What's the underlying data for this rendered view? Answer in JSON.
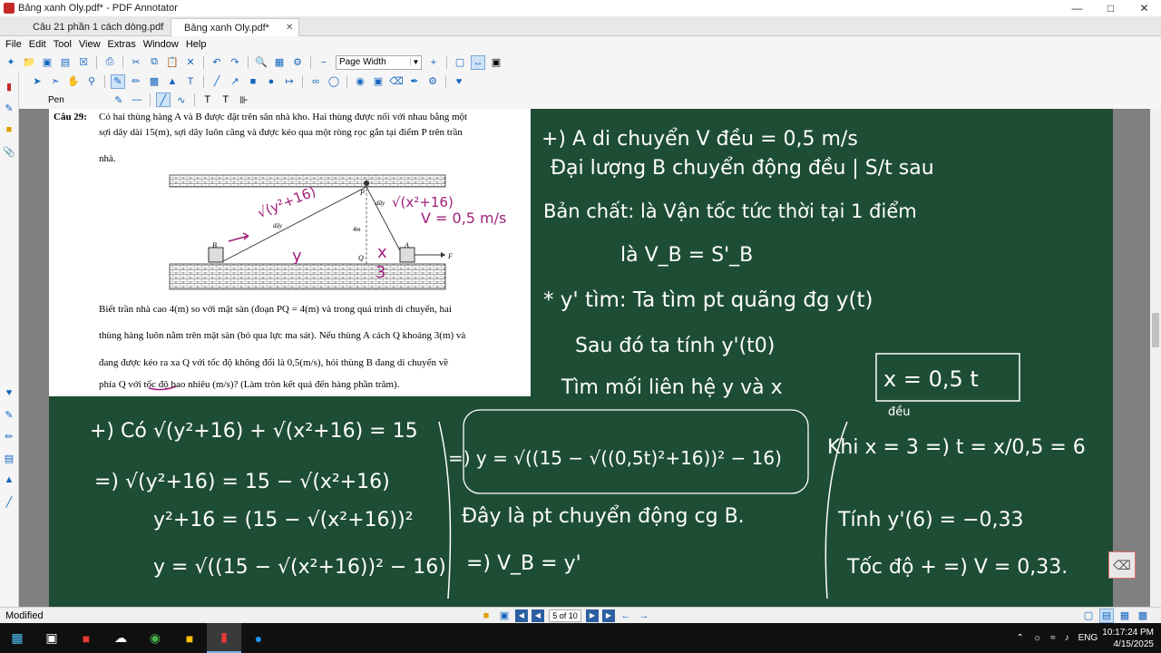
{
  "window": {
    "title": "Bảng xanh Oly.pdf* - PDF Annotator"
  },
  "tabs": [
    {
      "label": "Câu 21 phần 1 cách dòng.pdf"
    },
    {
      "label": "Bảng xanh Oly.pdf*"
    }
  ],
  "menu": [
    "File",
    "Edit",
    "Tool",
    "View",
    "Extras",
    "Window",
    "Help"
  ],
  "toolbar": {
    "zoom_mode": "Page Width",
    "pen_label": "Pen"
  },
  "question": {
    "number": "Câu 29:",
    "line1": "Có hai thùng hàng A và B được đặt trên sân nhà kho. Hai thùng được nối với nhau bằng một",
    "line2": "sợi dây dài 15(m), sợi dây luôn căng và được kéo qua một ròng rọc gắn tại điểm P trên trần",
    "line3": "nhà.",
    "line4": "Biết trần nhà cao 4(m) so với mặt sàn (đoạn PQ = 4(m) và trong quá trình di chuyển, hai",
    "line5": "thùng hàng luôn nằm trên mặt sàn (bỏ qua lực ma sát). Nếu thùng A cách Q khoảng 3(m) và",
    "line6": "đang được kéo ra xa Q với tốc độ không đổi là 0,5(m/s), hỏi thùng B đang di chuyển về",
    "line7": "phía Q với tốc độ bao nhiêu (m/s)? (Làm tròn kết quả đến hàng phần trăm).",
    "fig_labels": {
      "B": "B",
      "A": "A",
      "P": "P",
      "Q": "Q",
      "F": "F",
      "rope1": "dây",
      "rope2": "dây",
      "height": "4m"
    }
  },
  "annotations": {
    "fig_left": "√(y²+16)",
    "fig_right": "√(x²+16)",
    "fig_v": "V = 0,5 m/s",
    "fig_y": "y",
    "fig_x": "x",
    "fig_3": "3",
    "r1": "+) A di chuyển V đều = 0,5 m/s",
    "r2": "Đại lượng B chuyển động đều | S/t sau",
    "r3": "Bản chất: là Vận tốc tức thời tại 1 điểm",
    "r4": "là V_B = S'_B",
    "r5": "* y' tìm: Ta tìm pt quãng đg y(t)",
    "r6": "Sau đó ta tính y'(t0)",
    "r7": "Tìm mối liên hệ y và x",
    "r7b": "x = 0,5 t",
    "r7c": "đều",
    "l1": "+) Có √(y²+16) + √(x²+16) = 15",
    "l2": "=) √(y²+16) = 15 − √(x²+16)",
    "l3": "y²+16 = (15 − √(x²+16))²",
    "l4": "y = √((15 − √(x²+16))² − 16)",
    "m1": "=) y = √((15 − √((0,5t)²+16))² − 16)",
    "m2": "Đây là pt chuyển động cg B.",
    "m3": "=) V_B = y'",
    "k1": "Khi x = 3 =) t = x/0,5 = 6",
    "k2": "Tính y'(6) = −0,33",
    "k3": "Tốc độ + =) V = 0,33."
  },
  "status": {
    "modified": "Modified",
    "page": "5 of 10"
  },
  "taskbar": {
    "lang": "ENG",
    "time": "10:17:24 PM",
    "date": "4/15/2025"
  },
  "colors": {
    "board": "#1e4d35",
    "ink_purple": "#a0207a",
    "accent": "#1565c0"
  }
}
